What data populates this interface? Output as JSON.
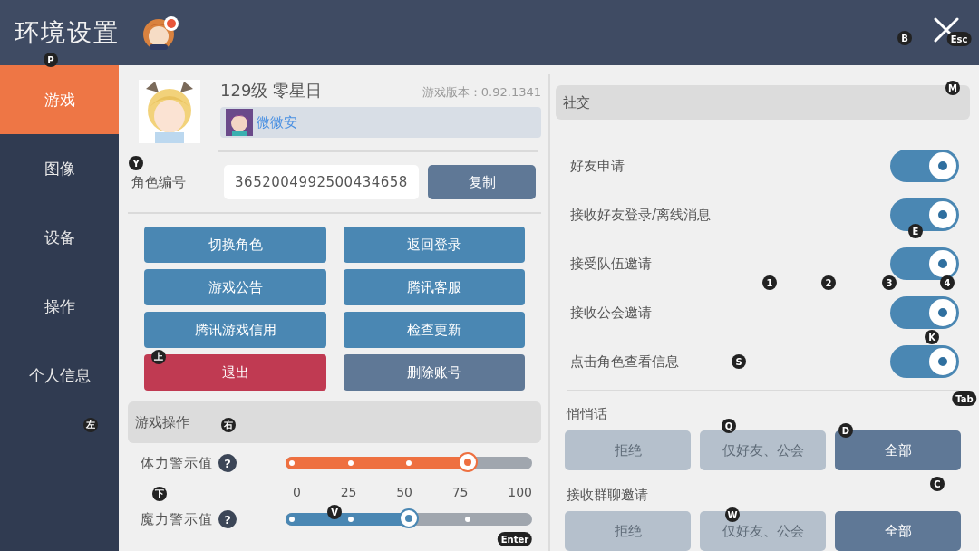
{
  "window": {
    "title": "环境设置"
  },
  "sidebar": {
    "items": [
      {
        "label": "游戏",
        "selected": true
      },
      {
        "label": "图像",
        "selected": false
      },
      {
        "label": "设备",
        "selected": false
      },
      {
        "label": "操作",
        "selected": false
      },
      {
        "label": "个人信息",
        "selected": false
      }
    ]
  },
  "profile": {
    "name": "129级 零星日",
    "version": "游戏版本：0.92.1341",
    "guild": "微微安",
    "id_label": "角色编号",
    "id_value": "3652004992500434658",
    "copy_button": "复制"
  },
  "actions": [
    {
      "label": "切换角色",
      "kind": "primary"
    },
    {
      "label": "返回登录",
      "kind": "primary"
    },
    {
      "label": "游戏公告",
      "kind": "primary"
    },
    {
      "label": "腾讯客服",
      "kind": "primary"
    },
    {
      "label": "腾讯游戏信用",
      "kind": "primary"
    },
    {
      "label": "检查更新",
      "kind": "primary"
    },
    {
      "label": "退出",
      "kind": "danger"
    },
    {
      "label": "删除账号",
      "kind": "muted"
    }
  ],
  "game_ops": {
    "title": "游戏操作",
    "sliders": [
      {
        "label": "体力警示值",
        "help": "?",
        "level": 0.75,
        "color": "#ee7040"
      },
      {
        "label": "魔力警示值",
        "help": "?",
        "level": 0.5,
        "color": "#4a87b3"
      }
    ],
    "scale": [
      "0",
      "25",
      "50",
      "75",
      "100"
    ]
  },
  "social": {
    "title": "社交",
    "toggles": [
      {
        "label": "好友申请",
        "on": true
      },
      {
        "label": "接收好友登录/离线消息",
        "on": true
      },
      {
        "label": "接受队伍邀请",
        "on": true
      },
      {
        "label": "接收公会邀请",
        "on": true
      },
      {
        "label": "点击角色查看信息",
        "on": true
      }
    ]
  },
  "choices": [
    {
      "title": "悄悄话",
      "options": [
        {
          "label": "拒绝",
          "selected": false
        },
        {
          "label": "仅好友、公会",
          "selected": false
        },
        {
          "label": "全部",
          "selected": true
        }
      ]
    },
    {
      "title": "接收群聊邀请",
      "options": [
        {
          "label": "拒绝",
          "selected": false
        },
        {
          "label": "仅好友、公会",
          "selected": false
        },
        {
          "label": "全部",
          "selected": true
        }
      ]
    }
  ],
  "key_hints": [
    "P",
    "B",
    "Esc",
    "Y",
    "M",
    "E",
    "1",
    "2",
    "3",
    "4",
    "K",
    "S",
    "Tab",
    "Q",
    "D",
    "C",
    "W",
    "上",
    "左",
    "右",
    "下",
    "V",
    "Enter"
  ]
}
